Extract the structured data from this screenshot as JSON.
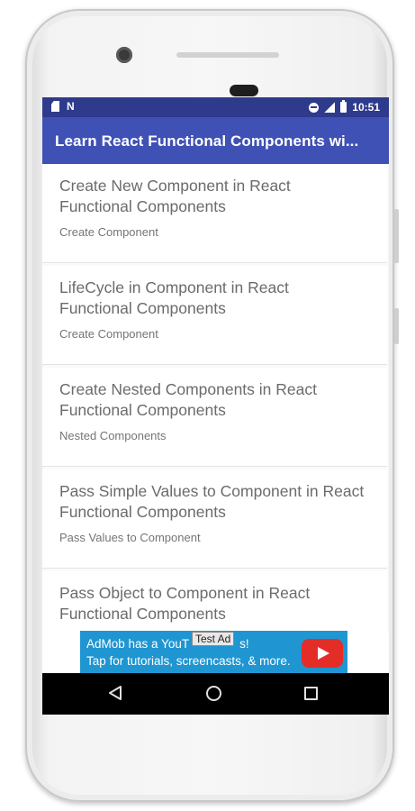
{
  "status_bar": {
    "time": "10:51",
    "icons": [
      "sd-card-icon",
      "nfc-n-icon",
      "do-not-disturb-icon",
      "signal-icon",
      "battery-icon"
    ]
  },
  "app_bar": {
    "title": "Learn React Functional Components wi..."
  },
  "list": {
    "items": [
      {
        "title": "Create New Component in React Functional Components",
        "subtitle": "Create Component"
      },
      {
        "title": "LifeCycle in Component in React Functional Components",
        "subtitle": "Create Component"
      },
      {
        "title": "Create Nested Components in React Functional Components",
        "subtitle": "Nested Components"
      },
      {
        "title": "Pass Simple Values to Component in React Functional Components",
        "subtitle": "Pass Values to Component"
      },
      {
        "title": "Pass Object to Component in React Functional Components",
        "subtitle": ""
      }
    ]
  },
  "ad_banner": {
    "line1": "AdMob has a YouT",
    "line1_tail": "s!",
    "line2": "Tap for tutorials, screencasts, & more.",
    "badge": "Test Ad",
    "icon": "youtube-play-icon"
  },
  "nav_bar": {
    "icons": [
      "back-icon",
      "home-icon",
      "recent-apps-icon"
    ]
  },
  "colors": {
    "status_bar": "#2e3b8c",
    "app_bar": "#3f51b5",
    "ad_background": "#1f95d1",
    "nav_bar": "#000000"
  }
}
